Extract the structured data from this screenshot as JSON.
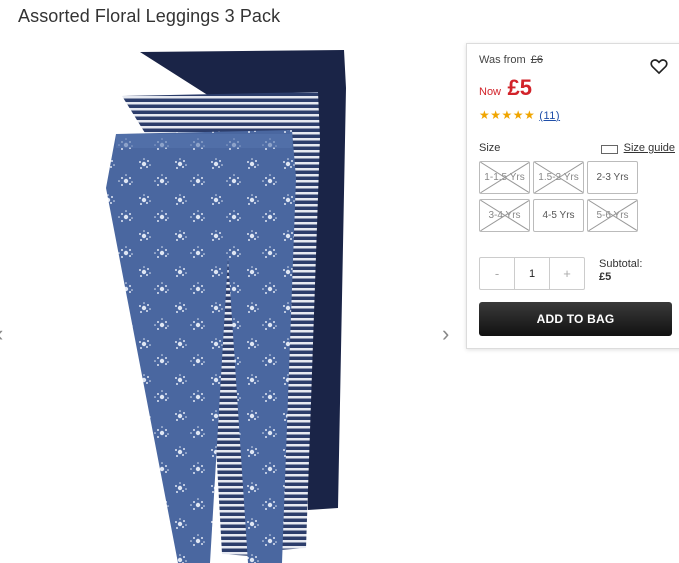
{
  "product": {
    "title": "Assorted Floral Leggings 3 Pack"
  },
  "gallery": {
    "prev_icon": "chevron-left-icon",
    "next_icon": "chevron-right-icon"
  },
  "price": {
    "was_label": "Was from",
    "was_value": "£6",
    "now_label": "Now",
    "now_value": "£5",
    "sale_color": "#d2232a"
  },
  "rating": {
    "stars": "★★★★★",
    "score": 5,
    "max": 5,
    "count": "11"
  },
  "size": {
    "label": "Size",
    "guide_label": "Size guide",
    "options": [
      {
        "label": "1-1.5 Yrs",
        "available": false
      },
      {
        "label": "1.5-2 Yrs",
        "available": false
      },
      {
        "label": "2-3 Yrs",
        "available": true
      },
      {
        "label": "3-4 Yrs",
        "available": false
      },
      {
        "label": "4-5 Yrs",
        "available": true
      },
      {
        "label": "5-6 Yrs",
        "available": false
      }
    ]
  },
  "quantity": {
    "minus": "-",
    "value": "1",
    "plus": "+"
  },
  "subtotal": {
    "label": "Subtotal:",
    "value": "£5"
  },
  "cta": {
    "add_to_bag": "ADD TO BAG"
  }
}
